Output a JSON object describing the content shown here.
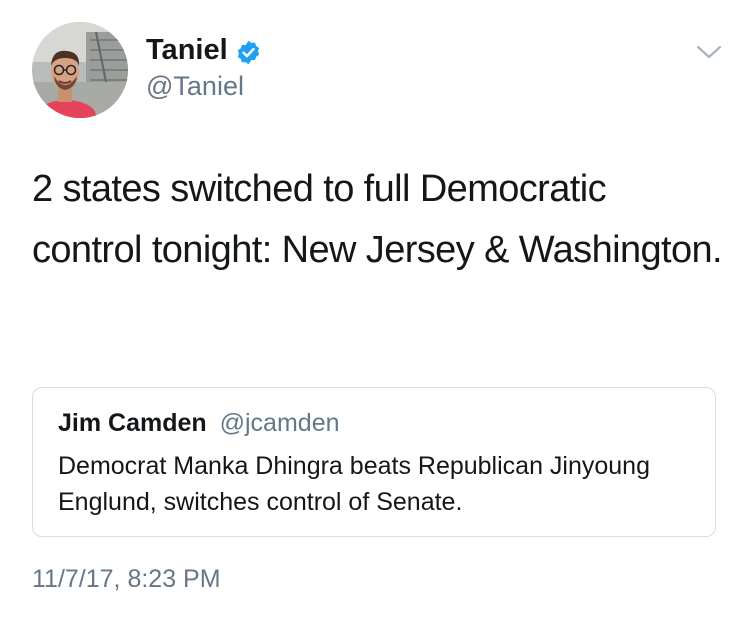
{
  "author": {
    "display_name": "Taniel",
    "handle": "@Taniel",
    "verified": true,
    "avatar_icon": "profile-photo"
  },
  "tweet": {
    "text": "2 states switched to full Democratic control tonight: New Jersey & Washington.",
    "timestamp": "11/7/17, 8:23 PM"
  },
  "quoted_tweet": {
    "display_name": "Jim Camden",
    "handle": "@jcamden",
    "text": "Democrat Manka Dhingra beats Republican Jinyoung Englund, switches control of Senate."
  },
  "menu": {
    "icon": "chevron-down-icon"
  },
  "colors": {
    "text": "#14171a",
    "secondary": "#657786",
    "verified": "#1da1f2",
    "border": "#d6dde3"
  }
}
